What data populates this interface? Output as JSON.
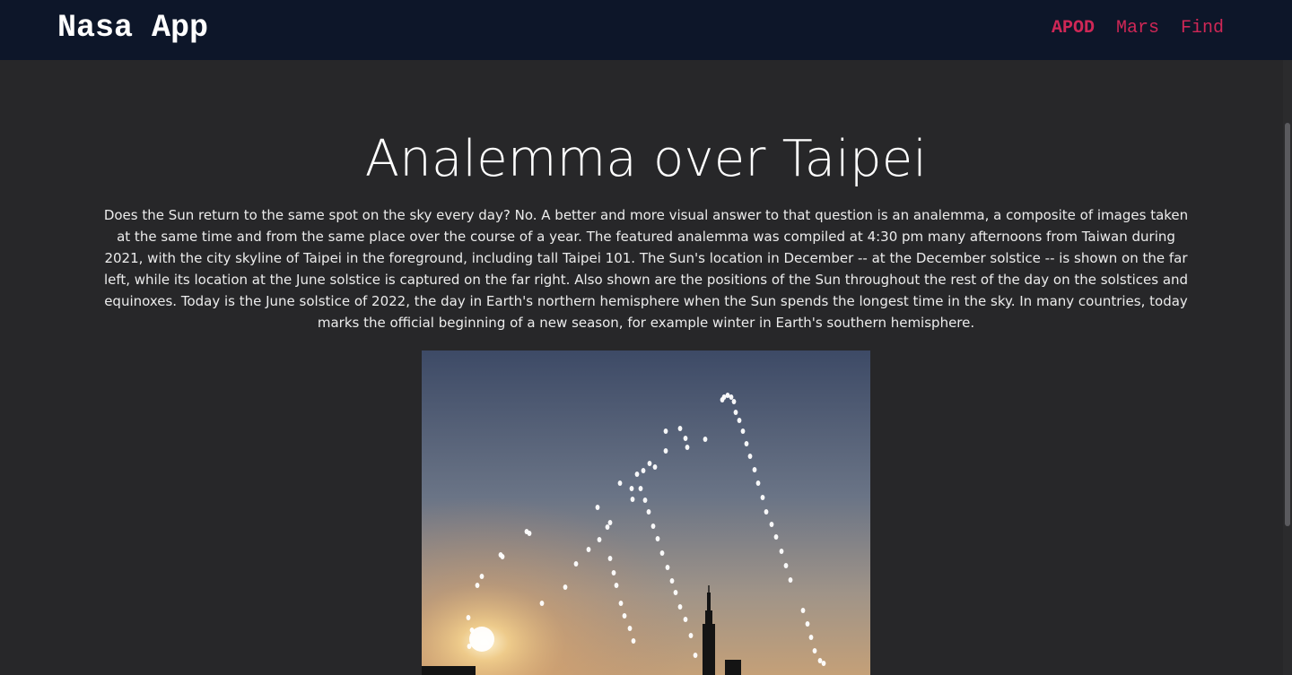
{
  "nav": {
    "brand": "Nasa App",
    "links": [
      {
        "label": "APOD",
        "active": true
      },
      {
        "label": "Mars",
        "active": false
      },
      {
        "label": "Find",
        "active": false
      }
    ]
  },
  "apod": {
    "title": "Analemma over Taipei",
    "explanation": "Does the Sun return to the same spot on the sky every day? No. A better and more visual answer to that question is an analemma, a composite of images taken at the same time and from the same place over the course of a year. The featured analemma was compiled at 4:30 pm many afternoons from Taiwan during 2021, with the city skyline of Taipei in the foreground, including tall Taipei 101. The Sun's location in December -- at the December solstice -- is shown on the far left, while its location at the June solstice is captured on the far right. Also shown are the positions of the Sun throughout the rest of the day on the solstices and equinoxes. Today is the June solstice of 2022, the day in Earth's northern hemisphere when the Sun spends the longest time in the sky. In many countries, today marks the official beginning of a new season, for example winter in Earth's southern hemisphere."
  },
  "colors": {
    "navbar_bg": "#0d1629",
    "page_bg": "#272729",
    "accent": "#cf2756"
  }
}
